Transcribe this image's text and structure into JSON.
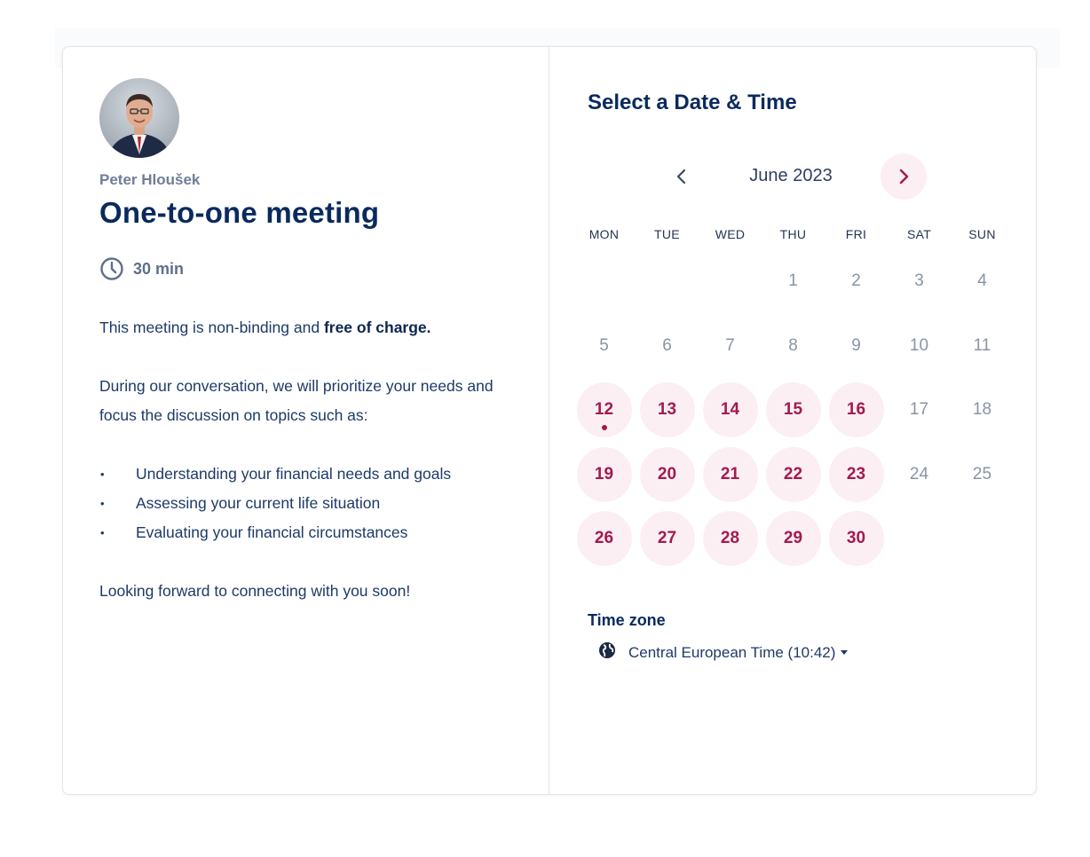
{
  "host": {
    "name": "Peter Hloušek"
  },
  "event": {
    "title": "One-to-one meeting",
    "duration": "30 min",
    "intro_prefix": "This meeting is non-binding and ",
    "intro_bold": "free of charge.",
    "paragraph": "During our conversation, we will prioritize your needs and focus the discussion on topics such as:",
    "topics": [
      "Understanding your financial needs and goals",
      "Assessing your current life situation",
      "Evaluating your financial circumstances"
    ],
    "closing": "Looking forward to connecting with you soon!"
  },
  "calendar": {
    "title": "Select a Date & Time",
    "month": "June 2023",
    "weekdays": [
      "MON",
      "TUE",
      "WED",
      "THU",
      "FRI",
      "SAT",
      "SUN"
    ],
    "leading_blanks": 3,
    "days": [
      {
        "d": "1",
        "a": false
      },
      {
        "d": "2",
        "a": false
      },
      {
        "d": "3",
        "a": false
      },
      {
        "d": "4",
        "a": false
      },
      {
        "d": "5",
        "a": false
      },
      {
        "d": "6",
        "a": false
      },
      {
        "d": "7",
        "a": false
      },
      {
        "d": "8",
        "a": false
      },
      {
        "d": "9",
        "a": false
      },
      {
        "d": "10",
        "a": false
      },
      {
        "d": "11",
        "a": false
      },
      {
        "d": "12",
        "a": true,
        "today": true
      },
      {
        "d": "13",
        "a": true
      },
      {
        "d": "14",
        "a": true
      },
      {
        "d": "15",
        "a": true
      },
      {
        "d": "16",
        "a": true
      },
      {
        "d": "17",
        "a": false
      },
      {
        "d": "18",
        "a": false
      },
      {
        "d": "19",
        "a": true
      },
      {
        "d": "20",
        "a": true
      },
      {
        "d": "21",
        "a": true
      },
      {
        "d": "22",
        "a": true
      },
      {
        "d": "23",
        "a": true
      },
      {
        "d": "24",
        "a": false
      },
      {
        "d": "25",
        "a": false
      },
      {
        "d": "26",
        "a": true
      },
      {
        "d": "27",
        "a": true
      },
      {
        "d": "28",
        "a": true
      },
      {
        "d": "29",
        "a": true
      },
      {
        "d": "30",
        "a": true
      }
    ]
  },
  "timezone": {
    "label": "Time zone",
    "value": "Central European Time (10:42)"
  },
  "colors": {
    "navy": "#0a2a5e",
    "accent": "#a31a4f",
    "accent_bg": "#fbeff4",
    "muted": "#8a93a4"
  },
  "icons": [
    "clock-icon",
    "chevron-left-icon",
    "chevron-right-icon",
    "globe-icon",
    "caret-down-icon"
  ]
}
